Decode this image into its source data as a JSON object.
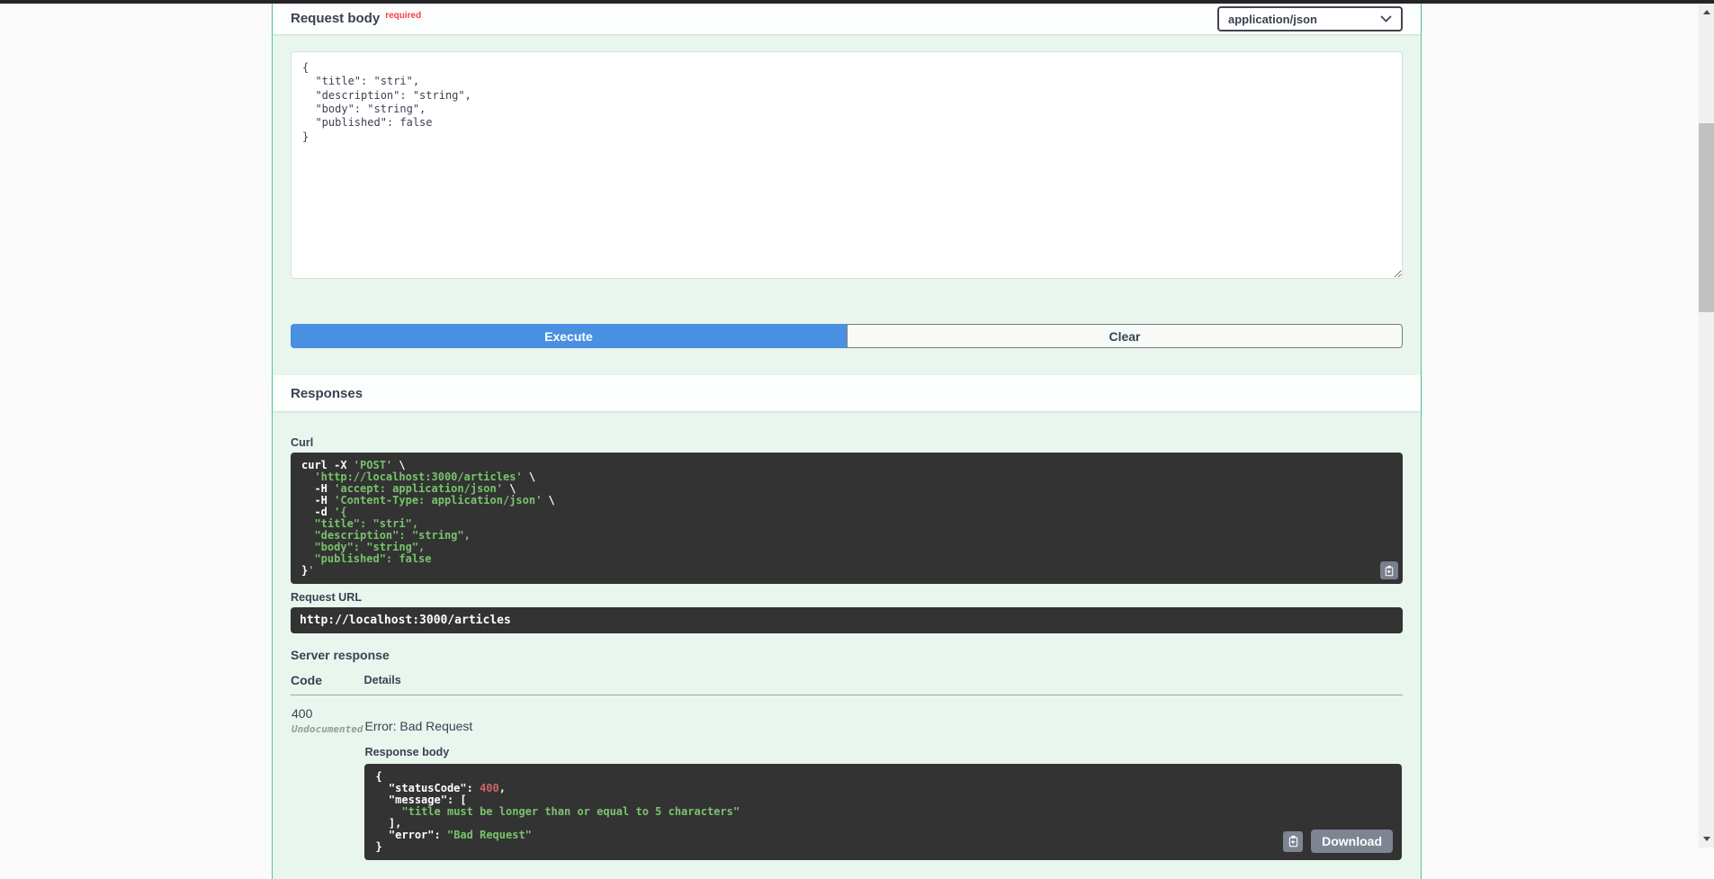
{
  "colors": {
    "post_green": "#49cc90",
    "opblock_bg": "#e9f6ee",
    "code_bg": "#333333",
    "string_green": "#79c36d",
    "number_red": "#d36363",
    "execute_blue": "#4990e2",
    "required_red": "#f93e3e",
    "heading_text": "#3b4151",
    "button_gray": "#7d8492"
  },
  "request_body": {
    "title": "Request body",
    "required_label": "required",
    "content_type": "application/json",
    "editor_value": "{\n  \"title\": \"stri\",\n  \"description\": \"string\",\n  \"body\": \"string\",\n  \"published\": false\n}"
  },
  "actions": {
    "execute_label": "Execute",
    "clear_label": "Clear"
  },
  "responses": {
    "title": "Responses",
    "curl_label": "Curl",
    "request_url_label": "Request URL",
    "request_url_value": "http://localhost:3000/articles",
    "server_response_label": "Server response",
    "table": {
      "code_header": "Code",
      "details_header": "Details"
    },
    "row": {
      "status_code": "400",
      "undocumented_label": "Undocumented",
      "description": "Error: Bad Request",
      "response_body_label": "Response body",
      "download_label": "Download"
    }
  },
  "icons": {
    "copy": "clipboard-copy",
    "select_chevron": "chevron-down",
    "scrollbar_up": "triangle-up",
    "scrollbar_down": "triangle-down"
  },
  "code_blocks": {
    "curl": [
      [
        {
          "t": "curl -X ",
          "c": "p"
        },
        {
          "t": "'POST'",
          "c": "s"
        },
        {
          "t": " \\",
          "c": "p"
        }
      ],
      [
        {
          "t": "  ",
          "c": "p"
        },
        {
          "t": "'http://localhost:3000/articles'",
          "c": "s"
        },
        {
          "t": " \\",
          "c": "p"
        }
      ],
      [
        {
          "t": "  -H ",
          "c": "p"
        },
        {
          "t": "'accept: application/json'",
          "c": "s"
        },
        {
          "t": " \\",
          "c": "p"
        }
      ],
      [
        {
          "t": "  -H ",
          "c": "p"
        },
        {
          "t": "'Content-Type: application/json'",
          "c": "s"
        },
        {
          "t": " \\",
          "c": "p"
        }
      ],
      [
        {
          "t": "  -d ",
          "c": "p"
        },
        {
          "t": "'{",
          "c": "s"
        }
      ],
      [
        {
          "t": "  \"title\": \"stri\",",
          "c": "s"
        }
      ],
      [
        {
          "t": "  \"description\": \"string\",",
          "c": "s"
        }
      ],
      [
        {
          "t": "  \"body\": \"string\",",
          "c": "s"
        }
      ],
      [
        {
          "t": "  \"published\": false",
          "c": "s"
        }
      ],
      [
        {
          "t": "}",
          "c": "p"
        },
        {
          "t": "'",
          "c": "s"
        }
      ]
    ],
    "response_body": [
      [
        {
          "t": "{",
          "c": "p"
        }
      ],
      [
        {
          "t": "  \"statusCode\": ",
          "c": "p"
        },
        {
          "t": "400",
          "c": "n"
        },
        {
          "t": ",",
          "c": "p"
        }
      ],
      [
        {
          "t": "  \"message\": [",
          "c": "p"
        }
      ],
      [
        {
          "t": "    ",
          "c": "p"
        },
        {
          "t": "\"title must be longer than or equal to 5 characters\"",
          "c": "s"
        }
      ],
      [
        {
          "t": "  ],",
          "c": "p"
        }
      ],
      [
        {
          "t": "  \"error\": ",
          "c": "p"
        },
        {
          "t": "\"Bad Request\"",
          "c": "s"
        }
      ],
      [
        {
          "t": "}",
          "c": "p"
        }
      ]
    ]
  }
}
